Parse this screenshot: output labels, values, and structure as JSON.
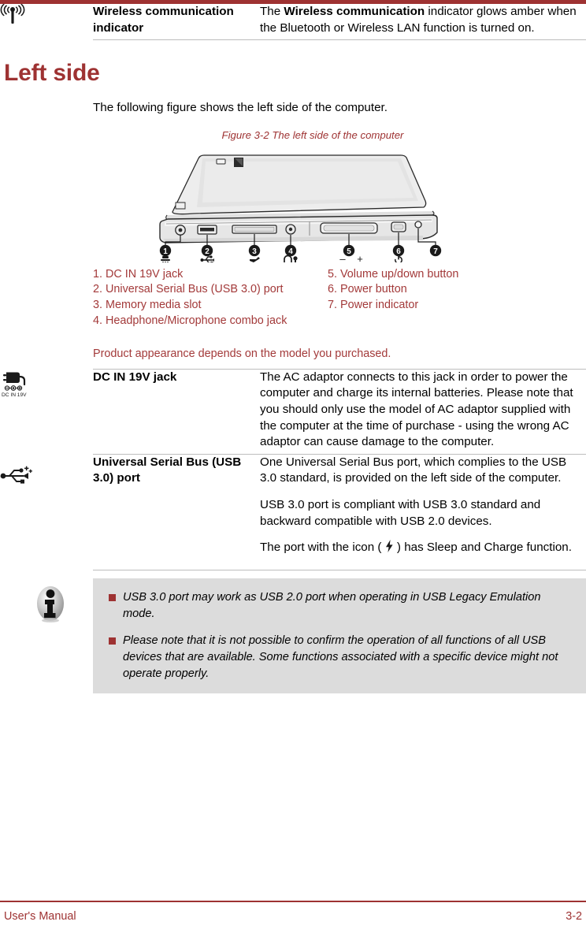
{
  "theme": {
    "accent": "#9e3232",
    "legend_red": "#a33a3a",
    "note_bg": "#dcdcdc",
    "rule_gray": "#bdbdbd"
  },
  "wireless_row": {
    "icon": "wireless-antenna-icon",
    "label": "Wireless communication indicator",
    "desc_pre": "The ",
    "desc_bold": "Wireless communication",
    "desc_post": " indicator glows amber when the Bluetooth or Wireless LAN function is turned on."
  },
  "section": {
    "title": "Left side",
    "intro": "The following figure shows the left side of the computer.",
    "figure_caption": "Figure 3-2 The left side of the computer"
  },
  "legend": {
    "left": [
      "1. DC IN 19V jack",
      "2. Universal Serial Bus (USB 3.0) port",
      "3. Memory media slot",
      "4. Headphone/Microphone combo jack"
    ],
    "right": [
      "5. Volume up/down button",
      "6. Power button",
      "7. Power indicator"
    ]
  },
  "appearance_note": "Product appearance depends on the model you purchased.",
  "dc_row": {
    "icon": "dc-in-plug-icon",
    "icon_caption": "DC IN 19V",
    "label": "DC IN 19V jack",
    "paragraphs": [
      "The AC adaptor connects to this jack in order to power the computer and charge its internal batteries. Please note that you should only use the model of AC adaptor supplied with the computer at the time of purchase - using the wrong AC adaptor can cause damage to the computer."
    ]
  },
  "usb_row": {
    "icon": "usb-plus-icon",
    "label": "Universal Serial Bus (USB 3.0) port",
    "paragraphs": [
      "One Universal Serial Bus port, which complies to the USB 3.0 standard, is provided on the left side of the computer.",
      "USB 3.0 port is compliant with USB 3.0 standard and backward compatible with USB 2.0 devices."
    ],
    "sleep_charge_pre": "The port with the icon ( ",
    "sleep_charge_post": " ) has Sleep and Charge function."
  },
  "note": {
    "icon": "info-icon",
    "items": [
      "USB 3.0 port may work as USB 2.0 port when operating in USB Legacy Emulation mode.",
      "Please note that it is not possible to confirm the operation of all functions of all USB devices that are available. Some functions associated with a specific device might not operate properly."
    ]
  },
  "footer": {
    "left": "User's Manual",
    "right": "3-2"
  },
  "figure": {
    "callouts": [
      "1",
      "2",
      "3",
      "4",
      "5",
      "6",
      "7"
    ],
    "port_symbols": [
      "dc-in-icon",
      "usb-icon",
      "sd-card-icon",
      "headphone-mic-icon",
      "volume-minus-plus-icon",
      "power-icon",
      ""
    ],
    "volume_minus": "–",
    "volume_plus": "+"
  }
}
